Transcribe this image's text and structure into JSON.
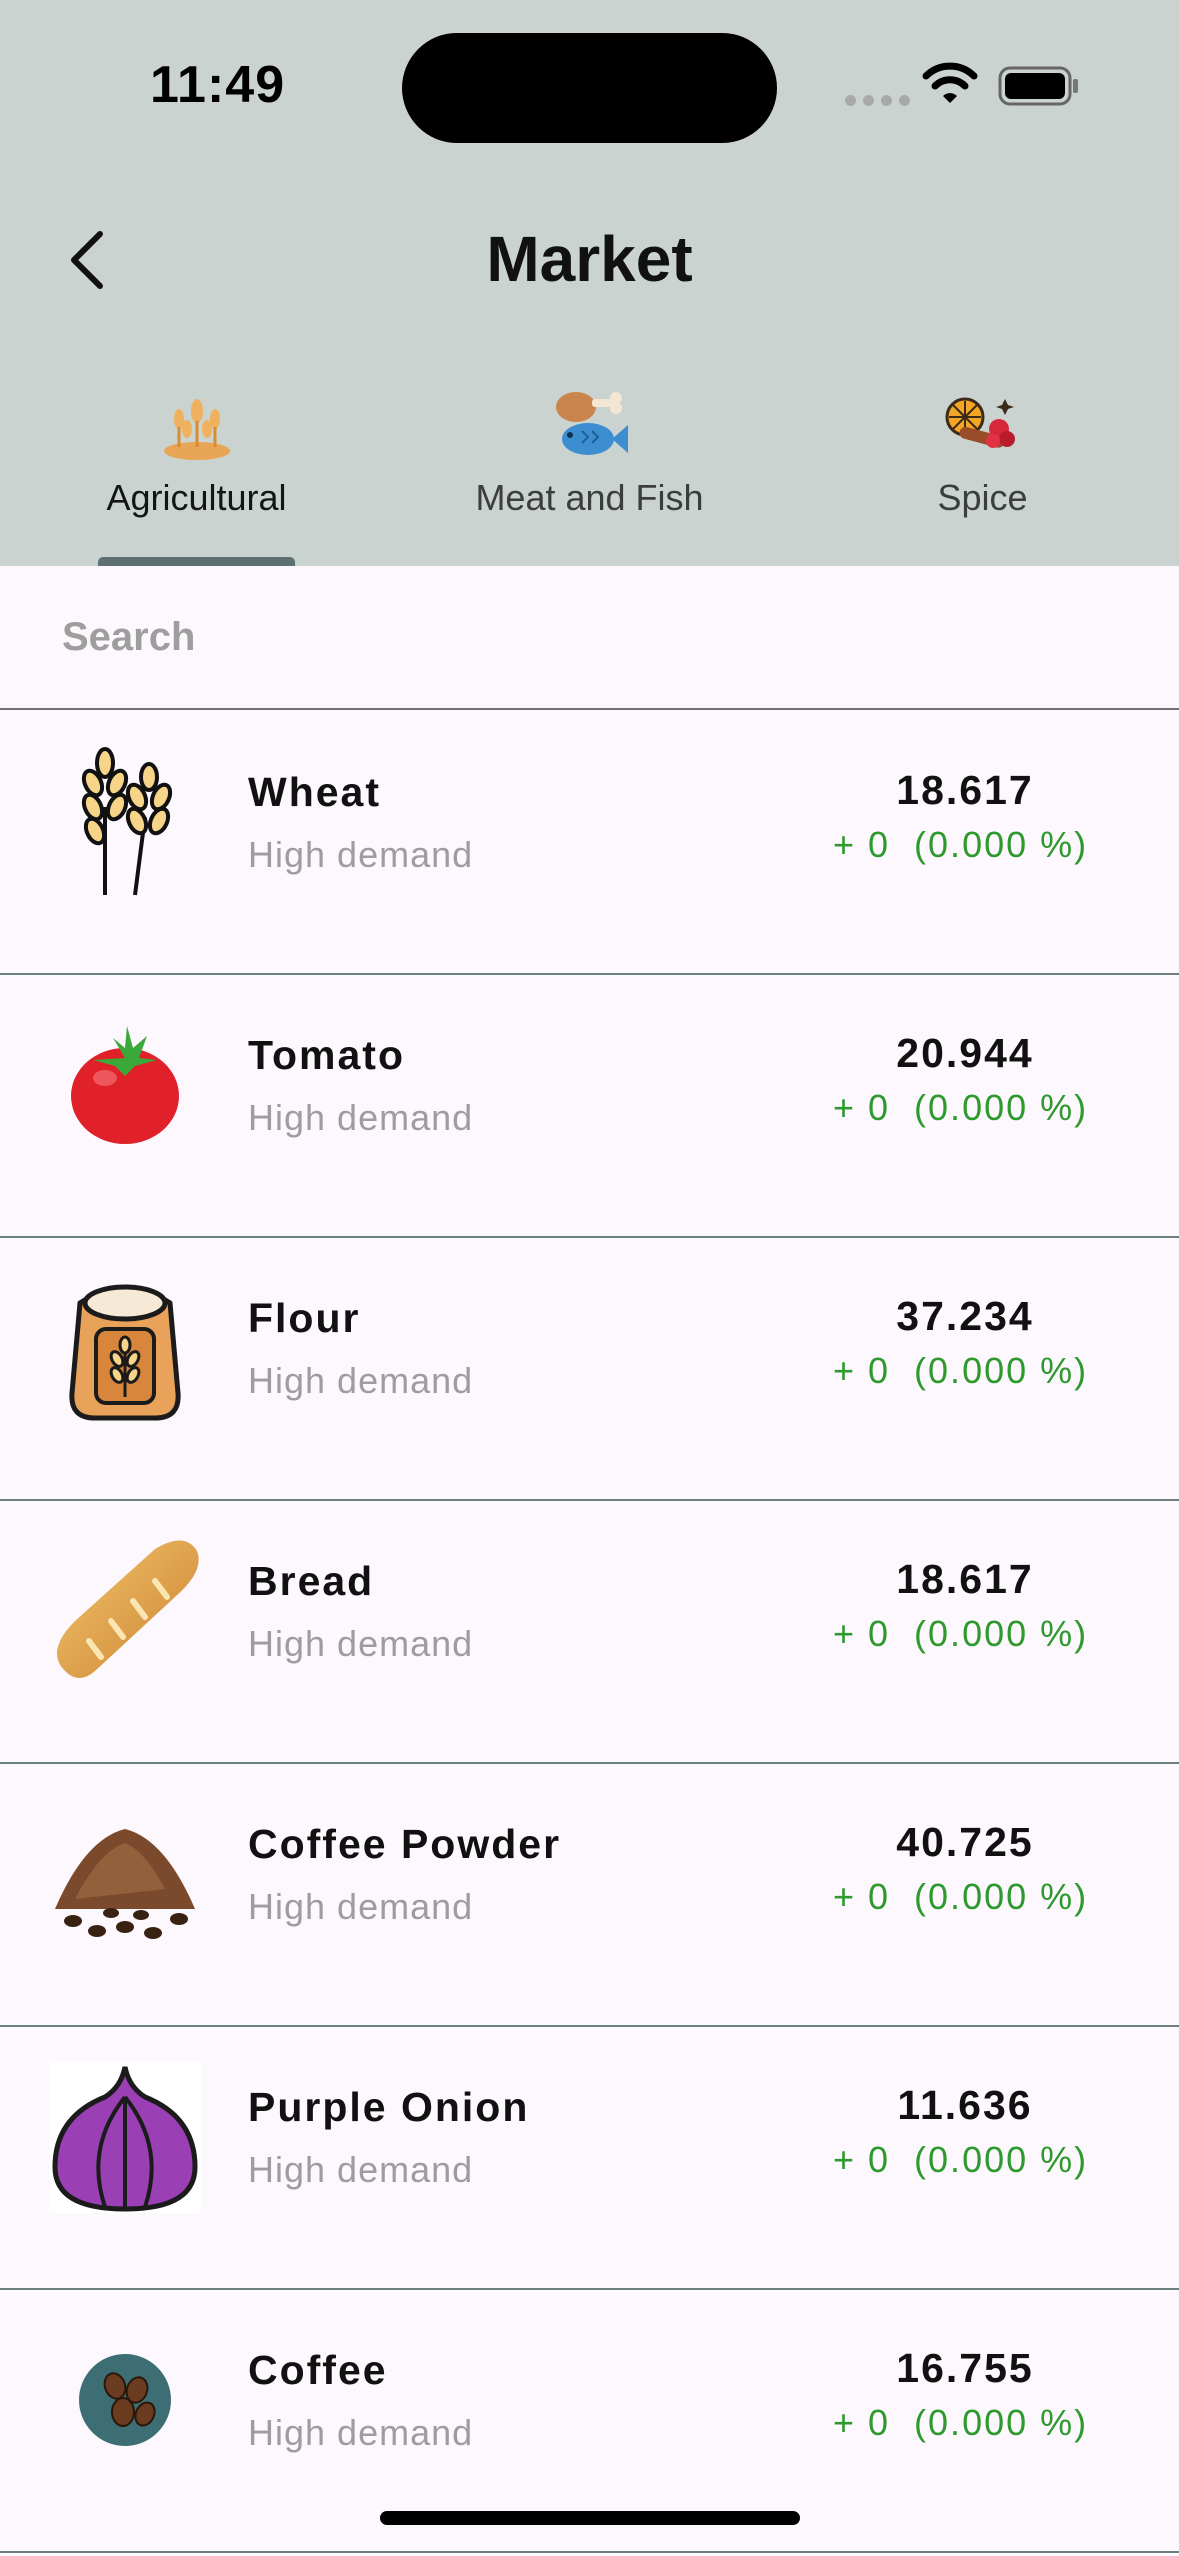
{
  "status_bar": {
    "time": "11:49"
  },
  "header": {
    "title": "Market"
  },
  "tabs": [
    {
      "label": "Agricultural",
      "icon": "wheat-field-icon",
      "active": true
    },
    {
      "label": "Meat and Fish",
      "icon": "meat-fish-icon",
      "active": false
    },
    {
      "label": "Spice",
      "icon": "spice-icon",
      "active": false
    }
  ],
  "search": {
    "placeholder": "Search"
  },
  "items": [
    {
      "name": "Wheat",
      "status": "High demand",
      "price": "18.617",
      "change": "+ 0  (0.000 %)",
      "icon": "wheat-icon"
    },
    {
      "name": "Tomato",
      "status": "High demand",
      "price": "20.944",
      "change": "+ 0  (0.000 %)",
      "icon": "tomato-icon"
    },
    {
      "name": "Flour",
      "status": "High demand",
      "price": "37.234",
      "change": "+ 0  (0.000 %)",
      "icon": "flour-sack-icon"
    },
    {
      "name": "Bread",
      "status": "High demand",
      "price": "18.617",
      "change": "+ 0  (0.000 %)",
      "icon": "bread-icon"
    },
    {
      "name": "Coffee Powder",
      "status": "High demand",
      "price": "40.725",
      "change": "+ 0  (0.000 %)",
      "icon": "coffee-powder-icon"
    },
    {
      "name": "Purple Onion",
      "status": "High demand",
      "price": "11.636",
      "change": "+ 0  (0.000 %)",
      "icon": "onion-icon"
    },
    {
      "name": "Coffee",
      "status": "High demand",
      "price": "16.755",
      "change": "+ 0  (0.000 %)",
      "icon": "coffee-beans-icon"
    }
  ],
  "colors": {
    "header_bg": "#cbd3d0",
    "positive": "#2e9a2e",
    "indicator": "#5d7173"
  }
}
